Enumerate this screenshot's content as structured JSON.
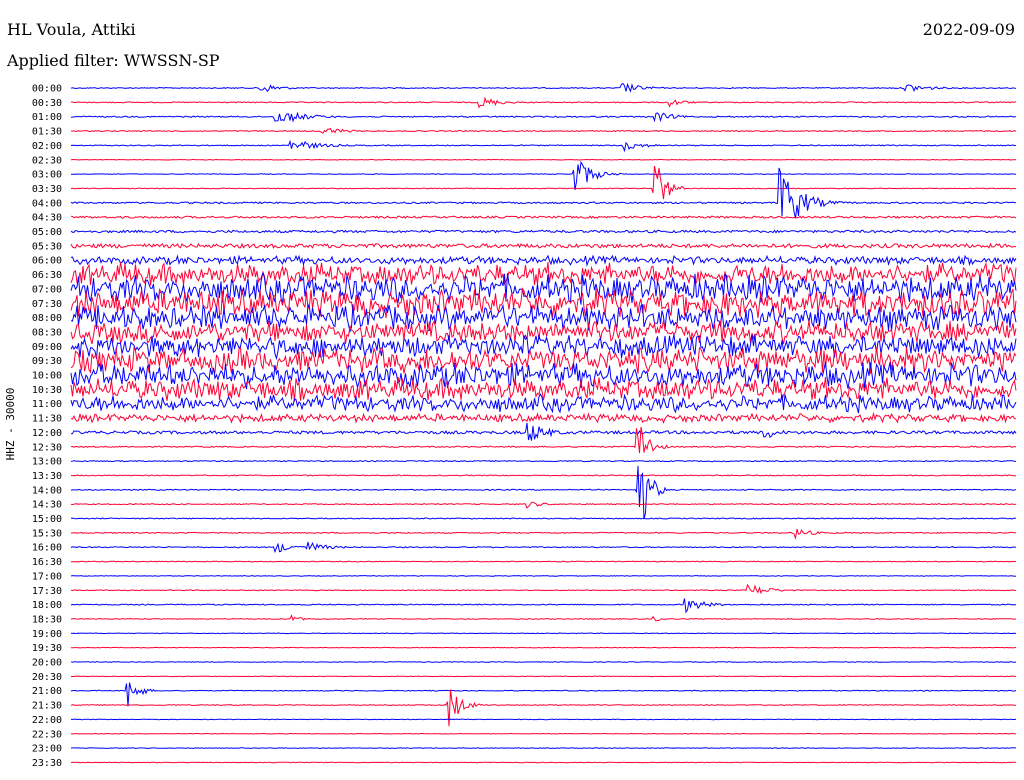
{
  "header": {
    "station": "HL Voula, Attiki",
    "date": "2022-09-09",
    "filter_label": "Applied filter:",
    "filter_name": "WWSSN-SP",
    "channel": "HHZ - 30000"
  },
  "colors": {
    "trace_a": "#0000ff",
    "trace_b": "#ff0033",
    "text": "#000000",
    "background": "#ffffff"
  },
  "chart_data": {
    "type": "helicorder",
    "title": "HL Voula, Attiki",
    "date": "2022-09-09",
    "ylabel": "HHZ - 30000",
    "xlabel": "",
    "grid": false,
    "row_labels": [
      "00:00",
      "00:30",
      "01:00",
      "01:30",
      "02:00",
      "02:30",
      "03:00",
      "03:30",
      "04:00",
      "04:30",
      "05:00",
      "05:30",
      "06:00",
      "06:30",
      "07:00",
      "07:30",
      "08:00",
      "08:30",
      "09:00",
      "09:30",
      "10:00",
      "10:30",
      "11:00",
      "11:30",
      "12:00",
      "12:30",
      "13:00",
      "13:30",
      "14:00",
      "14:30",
      "15:00",
      "15:30",
      "16:00",
      "16:30",
      "17:00",
      "17:30",
      "18:00",
      "18:30",
      "19:00",
      "19:30",
      "20:00",
      "20:30",
      "21:00",
      "21:30",
      "22:00",
      "22:30",
      "23:00",
      "23:30"
    ],
    "row_minutes": 30,
    "row_colors": [
      "blue",
      "red"
    ],
    "noise_level": [
      0.5,
      0.5,
      0.6,
      0.5,
      0.5,
      0.3,
      0.3,
      0.4,
      0.8,
      1.0,
      1.2,
      2.0,
      3.0,
      8.0,
      10.0,
      10.0,
      9.0,
      8.0,
      8.0,
      9.0,
      9.0,
      8.0,
      6.0,
      3.0,
      1.5,
      0.6,
      0.5,
      0.5,
      0.5,
      0.5,
      0.5,
      0.5,
      0.5,
      0.4,
      0.3,
      0.4,
      0.5,
      0.4,
      0.3,
      0.3,
      0.3,
      0.3,
      0.4,
      0.4,
      0.3,
      0.3,
      0.3,
      0.3
    ],
    "events": [
      {
        "row": 0,
        "minute": 6.0,
        "amplitude": 6,
        "duration": 2.0
      },
      {
        "row": 0,
        "minute": 17.5,
        "amplitude": 6,
        "duration": 2.0
      },
      {
        "row": 0,
        "minute": 26.5,
        "amplitude": 5,
        "duration": 2.5
      },
      {
        "row": 1,
        "minute": 13.0,
        "amplitude": 6,
        "duration": 2.0
      },
      {
        "row": 1,
        "minute": 19.0,
        "amplitude": 5,
        "duration": 1.5
      },
      {
        "row": 2,
        "minute": 6.5,
        "amplitude": 8,
        "duration": 3.0
      },
      {
        "row": 2,
        "minute": 18.5,
        "amplitude": 6,
        "duration": 2.0
      },
      {
        "row": 3,
        "minute": 8.0,
        "amplitude": 5,
        "duration": 2.0
      },
      {
        "row": 4,
        "minute": 7.0,
        "amplitude": 6,
        "duration": 3.0
      },
      {
        "row": 4,
        "minute": 17.5,
        "amplitude": 6,
        "duration": 2.0
      },
      {
        "row": 6,
        "minute": 16.0,
        "amplitude": 22,
        "duration": 1.5
      },
      {
        "row": 7,
        "minute": 18.5,
        "amplitude": 40,
        "duration": 1.0
      },
      {
        "row": 8,
        "minute": 22.5,
        "amplitude": 40,
        "duration": 2.0
      },
      {
        "row": 24,
        "minute": 14.5,
        "amplitude": 12,
        "duration": 2.0
      },
      {
        "row": 24,
        "minute": 22.0,
        "amplitude": 8,
        "duration": 1.5
      },
      {
        "row": 25,
        "minute": 18.0,
        "amplitude": 35,
        "duration": 1.0
      },
      {
        "row": 28,
        "minute": 18.0,
        "amplitude": 60,
        "duration": 1.0
      },
      {
        "row": 29,
        "minute": 14.5,
        "amplitude": 4,
        "duration": 1.5
      },
      {
        "row": 31,
        "minute": 23.0,
        "amplitude": 6,
        "duration": 1.5
      },
      {
        "row": 32,
        "minute": 6.5,
        "amplitude": 6,
        "duration": 2.0
      },
      {
        "row": 32,
        "minute": 7.5,
        "amplitude": 6,
        "duration": 2.0
      },
      {
        "row": 35,
        "minute": 21.5,
        "amplitude": 7,
        "duration": 2.0
      },
      {
        "row": 36,
        "minute": 19.5,
        "amplitude": 8,
        "duration": 2.0
      },
      {
        "row": 37,
        "minute": 7.0,
        "amplitude": 4,
        "duration": 1.0
      },
      {
        "row": 37,
        "minute": 18.5,
        "amplitude": 3,
        "duration": 1.0
      },
      {
        "row": 42,
        "minute": 1.8,
        "amplitude": 20,
        "duration": 1.0
      },
      {
        "row": 43,
        "minute": 12.0,
        "amplitude": 22,
        "duration": 1.2
      }
    ]
  }
}
